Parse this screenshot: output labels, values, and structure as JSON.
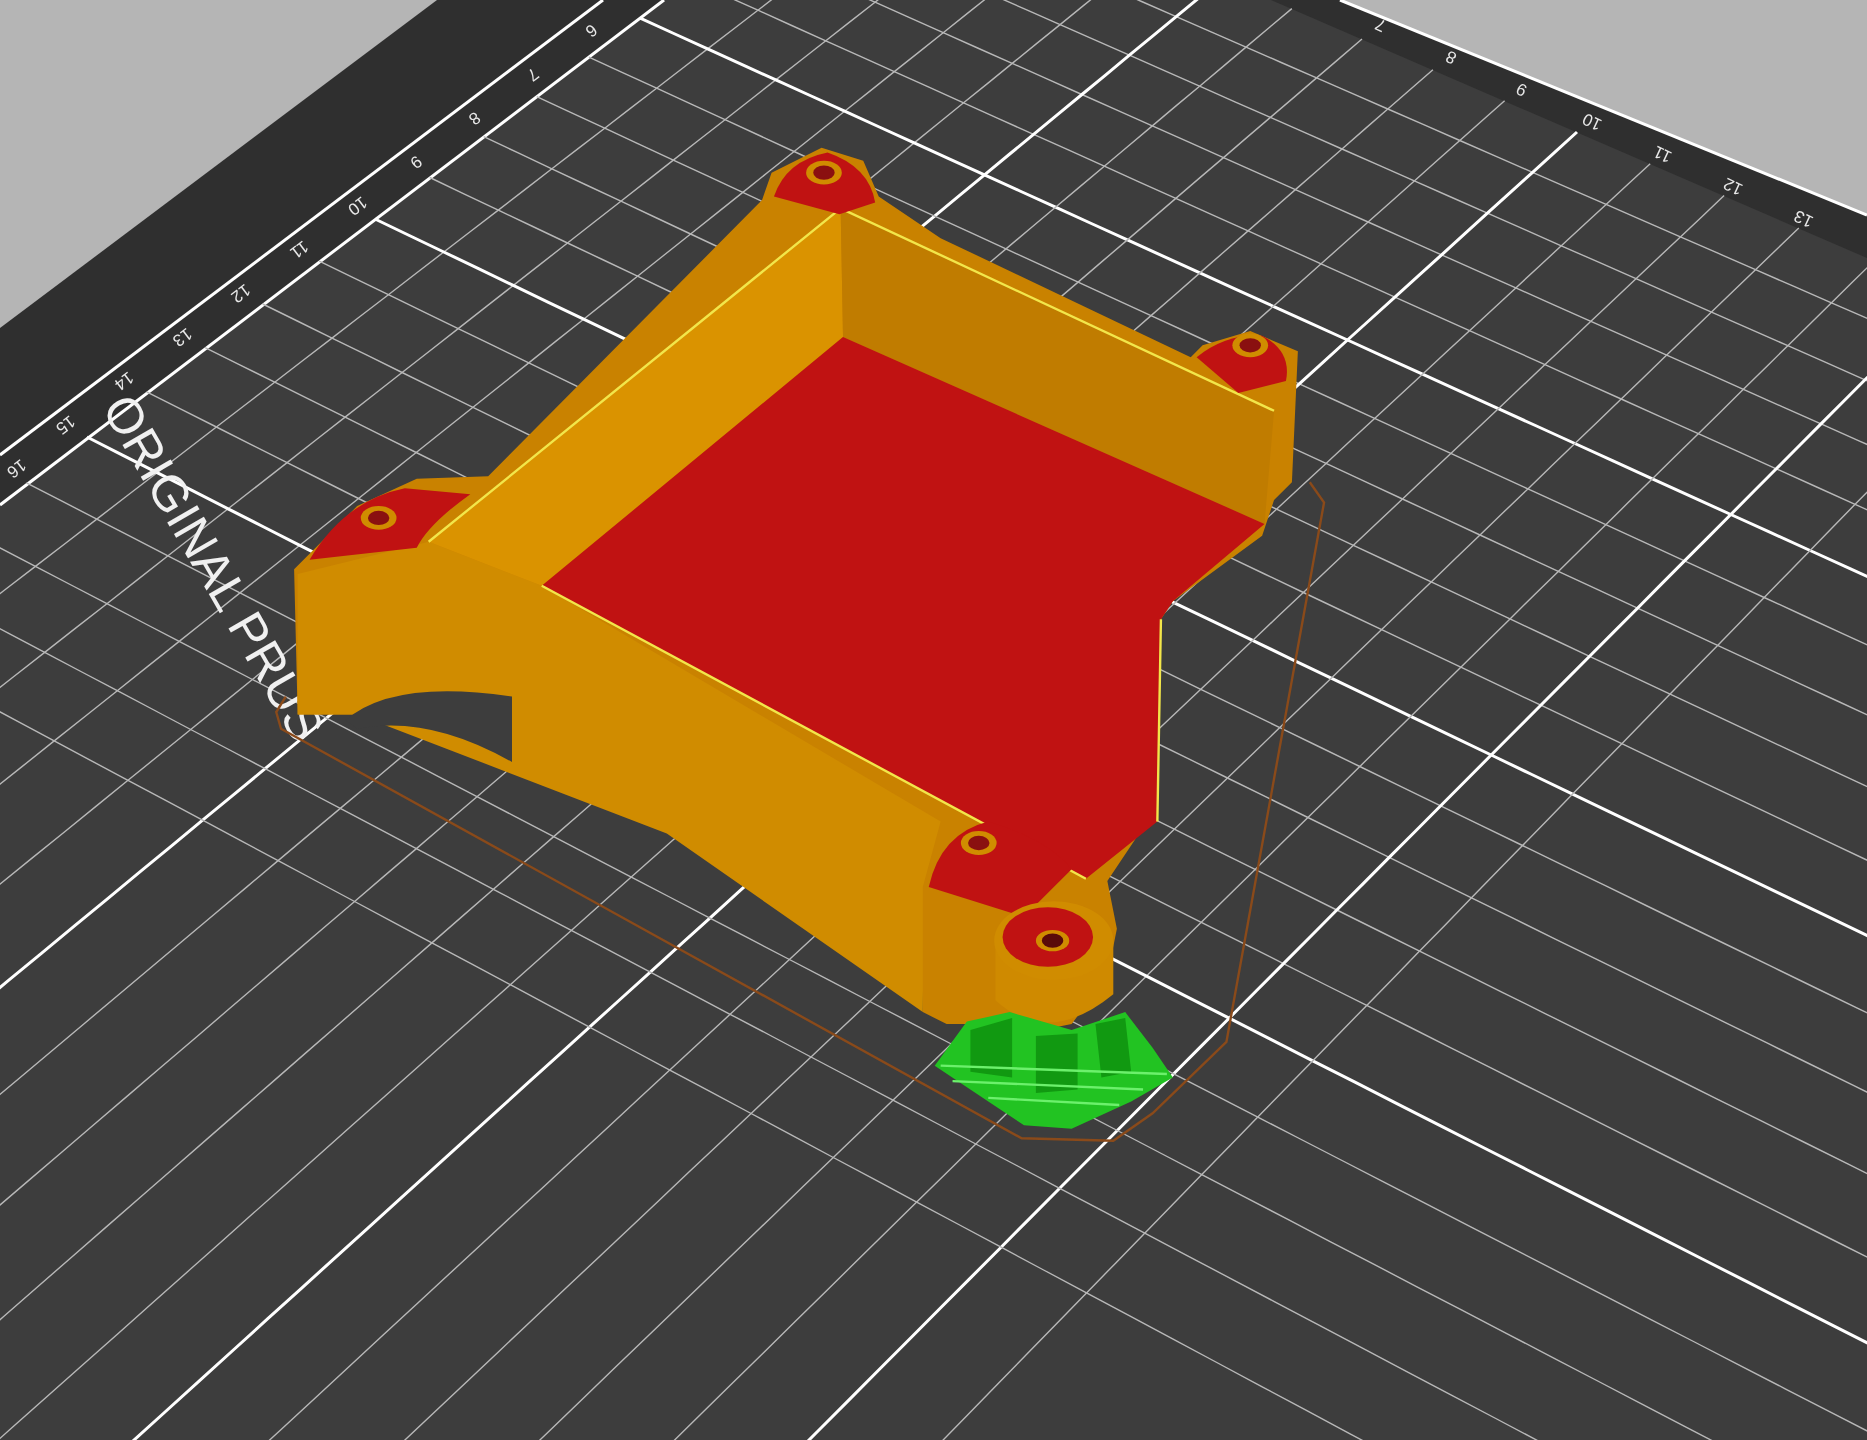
{
  "viewport": {
    "bed": {
      "left_edge_labels": [
        "6",
        "7",
        "8",
        "9",
        "10",
        "11",
        "12",
        "13",
        "14",
        "15",
        "16"
      ],
      "right_edge_labels": [
        "7",
        "8",
        "9",
        "10",
        "11",
        "12",
        "13"
      ],
      "logo_text": "ORIGINAL PRUS"
    }
  }
}
